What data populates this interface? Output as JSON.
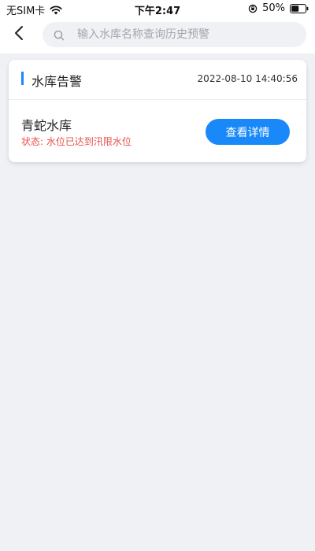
{
  "status_bar": {
    "carrier": "无SIM卡",
    "time": "下午2:47",
    "battery": "50%"
  },
  "header": {
    "search": {
      "placeholder": "输入水库名称查询历史预警",
      "value": ""
    }
  },
  "alert_card": {
    "title": "水库告警",
    "time": "2022-08-10 14:40:56",
    "reservoir_name": "青蛇水库",
    "status": "状态: 水位已达到汛限水位",
    "button_label": "查看详情"
  },
  "colors": {
    "accent": "#1989fa",
    "warning": "#e8514a",
    "background": "#f0f1f5"
  },
  "icons": {
    "wifi": "wifi-icon",
    "rotation_lock": "rotation-lock-icon",
    "battery": "battery-icon",
    "back": "chevron-left-icon",
    "search": "search-icon"
  }
}
